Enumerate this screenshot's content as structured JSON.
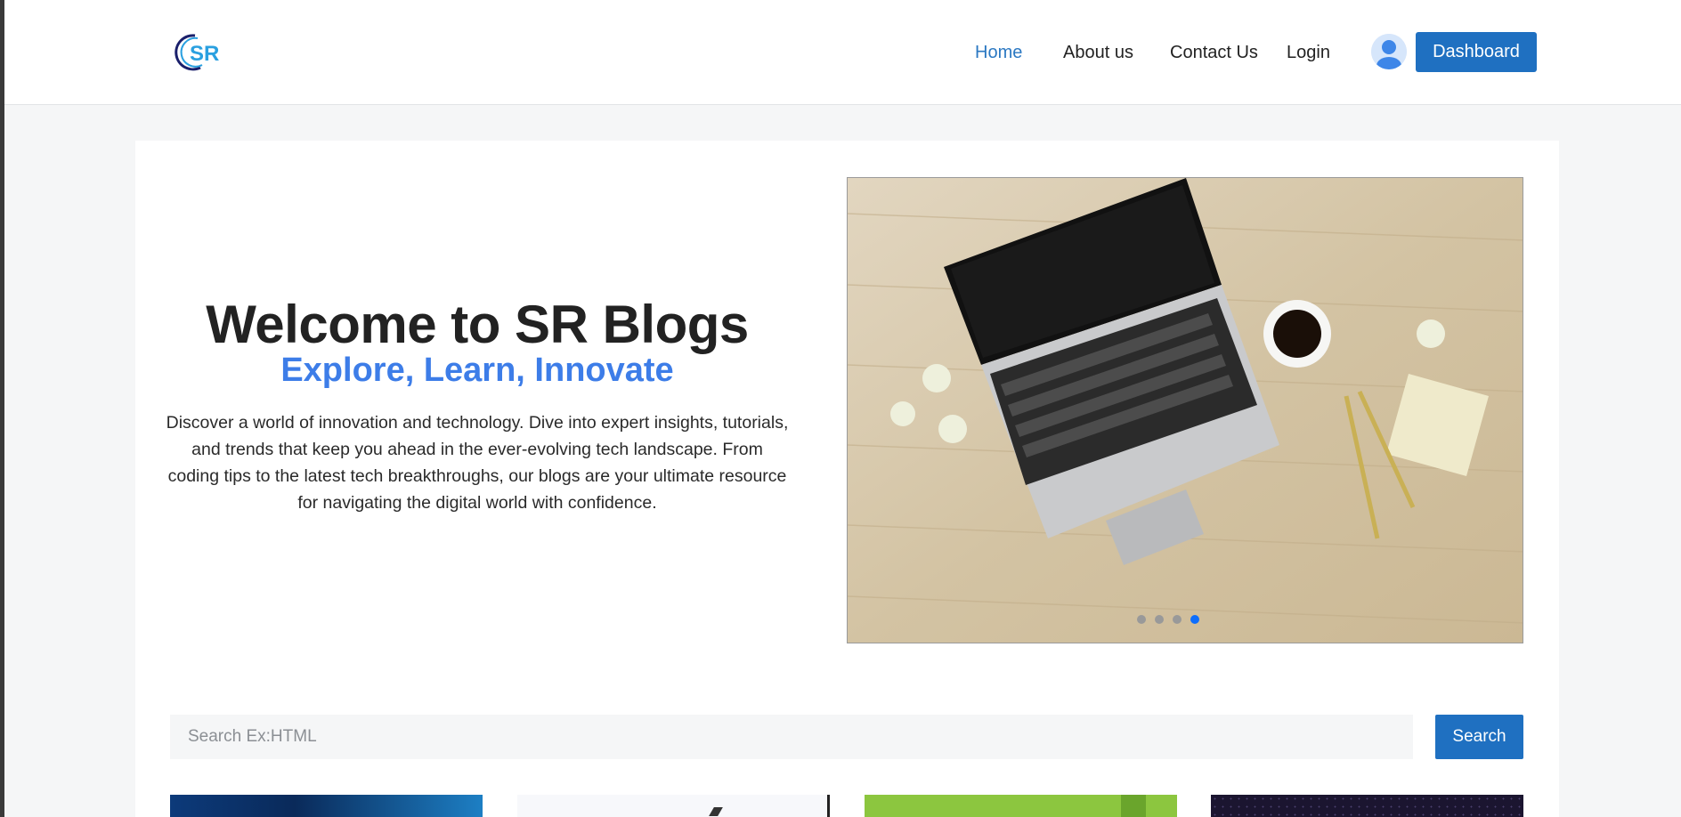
{
  "header": {
    "logo_text": "SR",
    "nav": [
      {
        "label": "Home",
        "active": true
      },
      {
        "label": "About us",
        "active": false
      },
      {
        "label": "Contact Us",
        "active": false
      },
      {
        "label": "Login",
        "active": false
      }
    ],
    "dashboard_label": "Dashboard",
    "avatar_icon": "user-avatar-icon"
  },
  "hero": {
    "title": "Welcome to SR Blogs",
    "subtitle": "Explore, Learn, Innovate",
    "description": "Discover a world of innovation and technology. Dive into expert insights, tutorials, and trends that keep you ahead in the ever-evolving tech landscape. From coding tips to the latest tech breakthroughs, our blogs are your ultimate resource for navigating the digital world with confidence."
  },
  "carousel": {
    "slide_count": 4,
    "active_index": 3,
    "image_subject": "laptop-on-wooden-desk"
  },
  "search": {
    "placeholder": "Search Ex:HTML",
    "value": "",
    "button_label": "Search"
  },
  "colors": {
    "accent": "#1f70c1",
    "subtitle": "#3d7de8",
    "active_nav": "#2b78c2",
    "active_dot": "#0d6efd"
  }
}
